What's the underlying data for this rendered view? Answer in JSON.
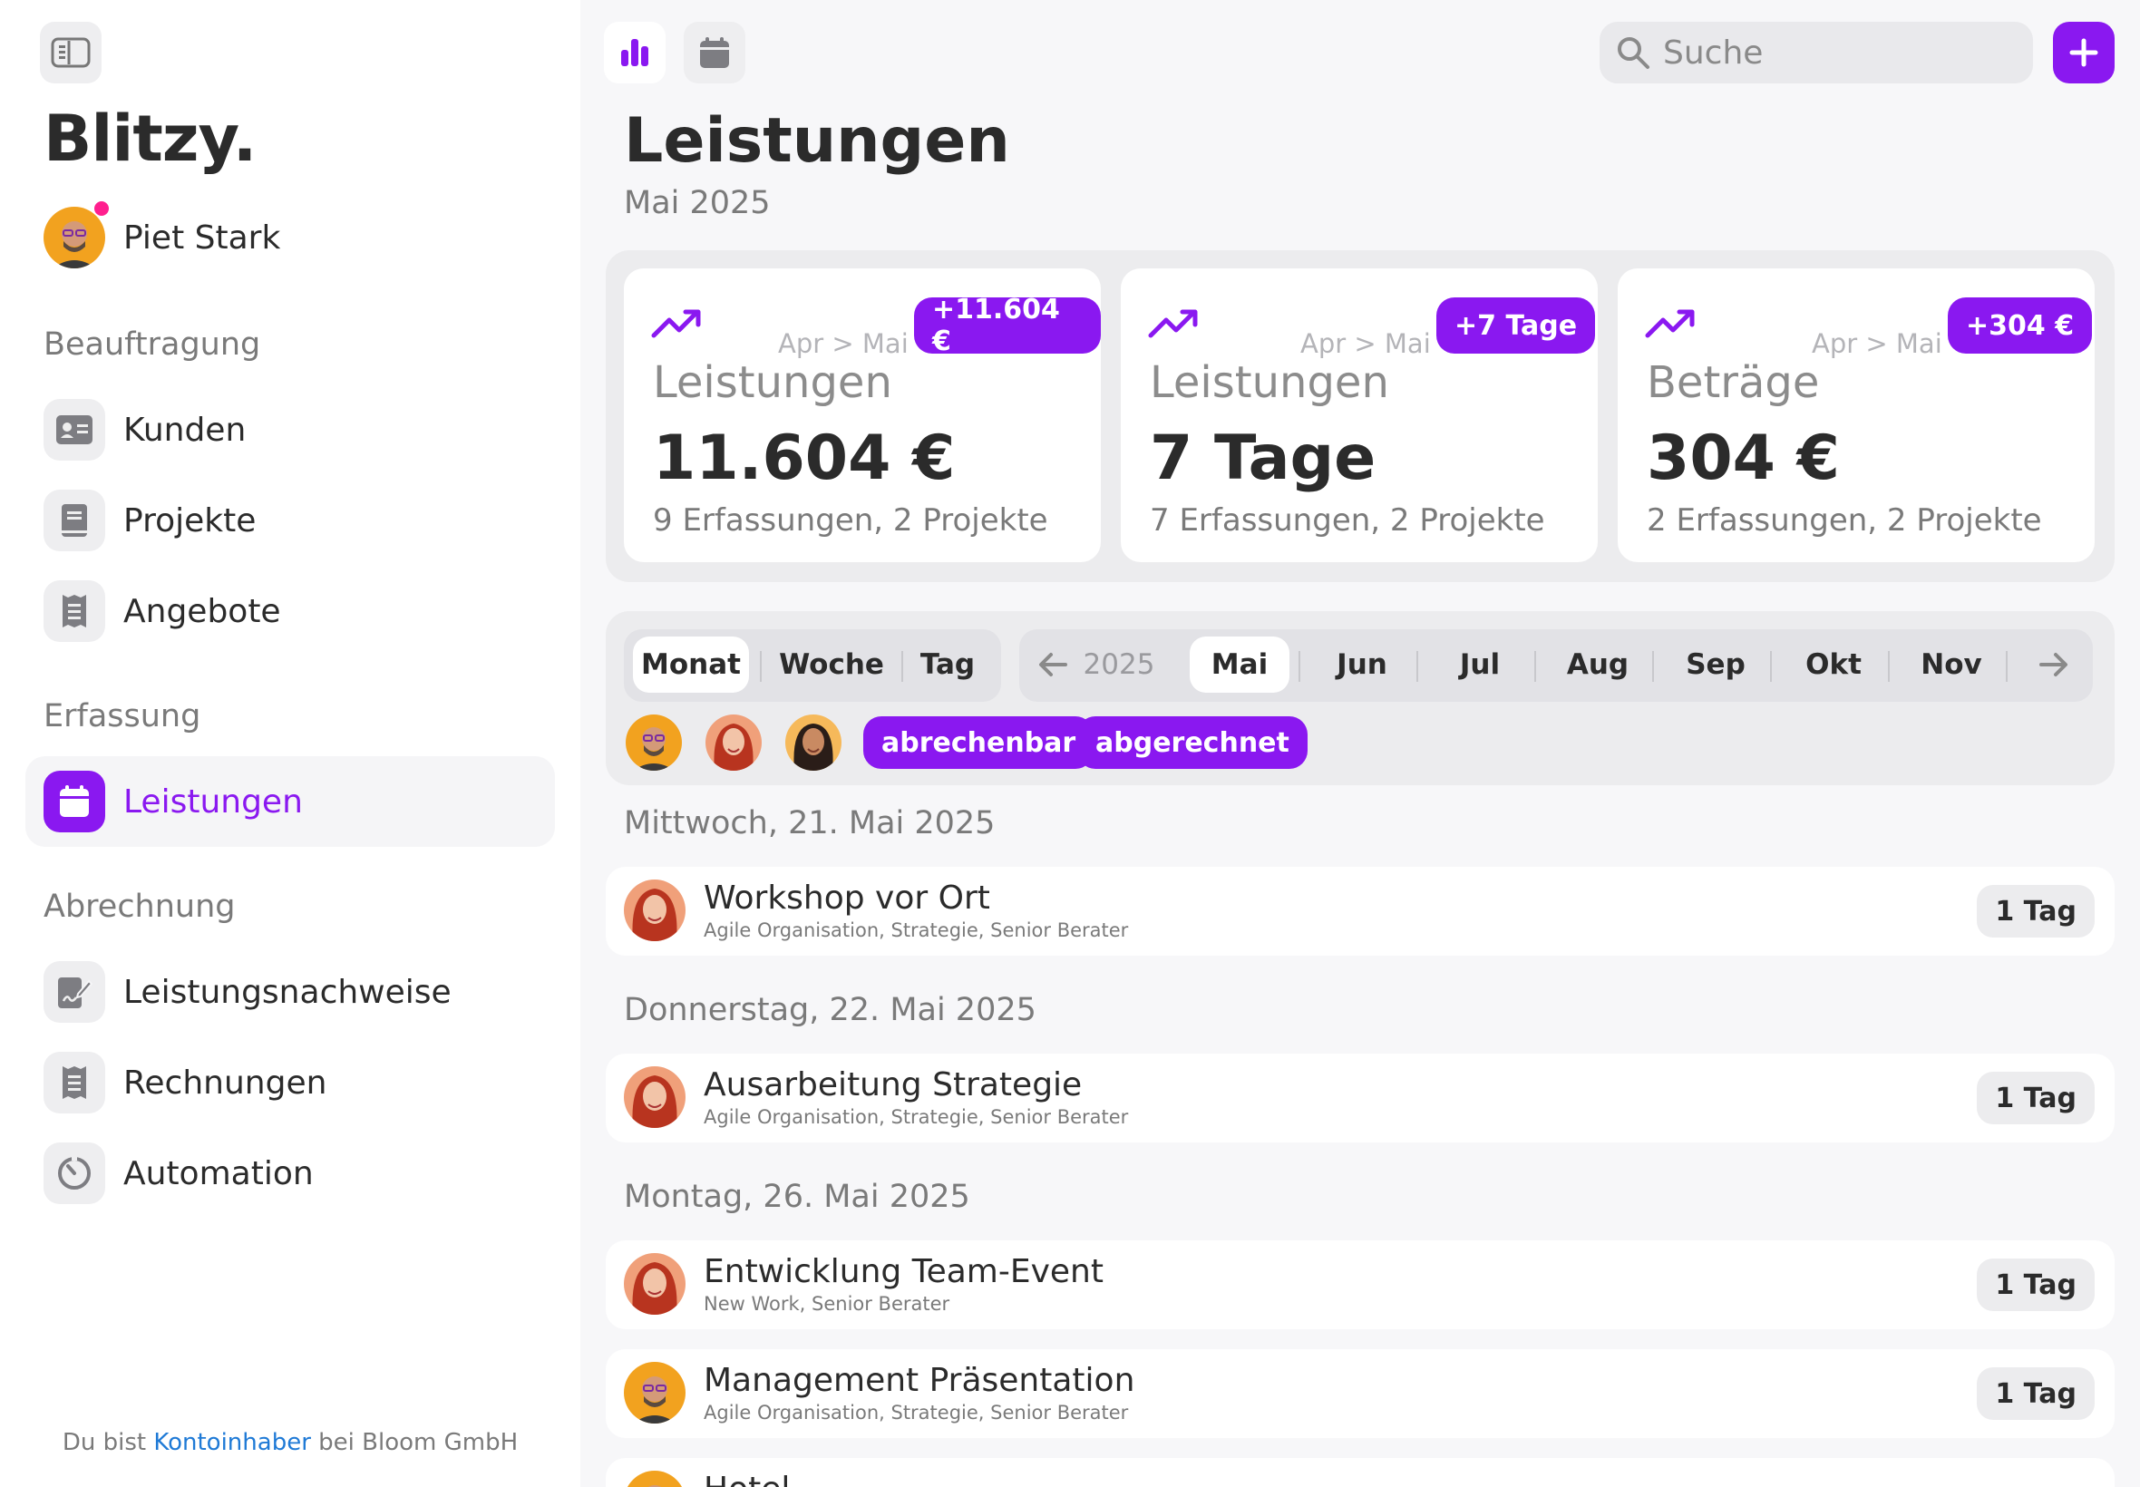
{
  "brand": "Blitzy.",
  "user": {
    "name": "Piet Stark"
  },
  "sidebar": {
    "sections": [
      {
        "title": "Beauftragung"
      },
      {
        "title": "Erfassung"
      },
      {
        "title": "Abrechnung"
      }
    ],
    "items": [
      {
        "label": "Kunden",
        "icon": "id-card-icon"
      },
      {
        "label": "Projekte",
        "icon": "book-icon"
      },
      {
        "label": "Angebote",
        "icon": "receipt-icon"
      },
      {
        "label": "Leistungen",
        "icon": "calendar-icon",
        "active": true
      },
      {
        "label": "Leistungsnachweise",
        "icon": "signed-document-icon"
      },
      {
        "label": "Rechnungen",
        "icon": "receipt-icon"
      },
      {
        "label": "Automation",
        "icon": "timer-icon"
      }
    ],
    "footer": {
      "prefix": "Du bist ",
      "link": "Kontoinhaber",
      "suffix": " bei Bloom GmbH"
    }
  },
  "toolbar": {
    "view_chart_icon": "bar-chart-icon",
    "view_calendar_icon": "calendar-icon",
    "search_placeholder": "Suche",
    "add_label": "+"
  },
  "page": {
    "title": "Leistungen",
    "subtitle": "Mai 2025"
  },
  "stats": [
    {
      "compare": "Apr > Mai",
      "badge": "+11.604 €",
      "label": "Leistungen",
      "value": "11.604 €",
      "detail": "9 Erfassungen, 2 Projekte"
    },
    {
      "compare": "Apr > Mai",
      "badge": "+7 Tage",
      "label": "Leistungen",
      "value": "7 Tage",
      "detail": "7 Erfassungen, 2 Projekte"
    },
    {
      "compare": "Apr > Mai",
      "badge": "+304 €",
      "label": "Beträge",
      "value": "304 €",
      "detail": "2 Erfassungen, 2 Projekte"
    }
  ],
  "filters": {
    "periods": [
      "Monat",
      "Woche",
      "Tag"
    ],
    "active_period": "Monat",
    "year": "2025",
    "months": [
      "Mai",
      "Jun",
      "Jul",
      "Aug",
      "Sep",
      "Okt",
      "Nov"
    ],
    "active_month": "Mai",
    "chips": [
      "abrechenbar",
      "abgerechnet"
    ]
  },
  "days": [
    {
      "title": "Mittwoch, 21. Mai 2025",
      "entries": [
        {
          "title": "Workshop vor Ort",
          "subtitle": "Agile Organisation, Strategie, Senior Berater",
          "duration": "1 Tag"
        }
      ]
    },
    {
      "title": "Donnerstag, 22. Mai 2025",
      "entries": [
        {
          "title": "Ausarbeitung Strategie",
          "subtitle": "Agile Organisation, Strategie, Senior Berater",
          "duration": "1 Tag"
        }
      ]
    },
    {
      "title": "Montag, 26. Mai 2025",
      "entries": [
        {
          "title": "Entwicklung Team-Event",
          "subtitle": "New Work, Senior Berater",
          "duration": "1 Tag"
        },
        {
          "title": "Management Präsentation",
          "subtitle": "Agile Organisation, Strategie, Senior Berater",
          "duration": "1 Tag"
        },
        {
          "title": "Hotel",
          "subtitle": "",
          "duration": ""
        }
      ]
    }
  ],
  "colors": {
    "accent": "#8a18f0",
    "online": "#ff1f8e",
    "link": "#1f7ad6"
  }
}
